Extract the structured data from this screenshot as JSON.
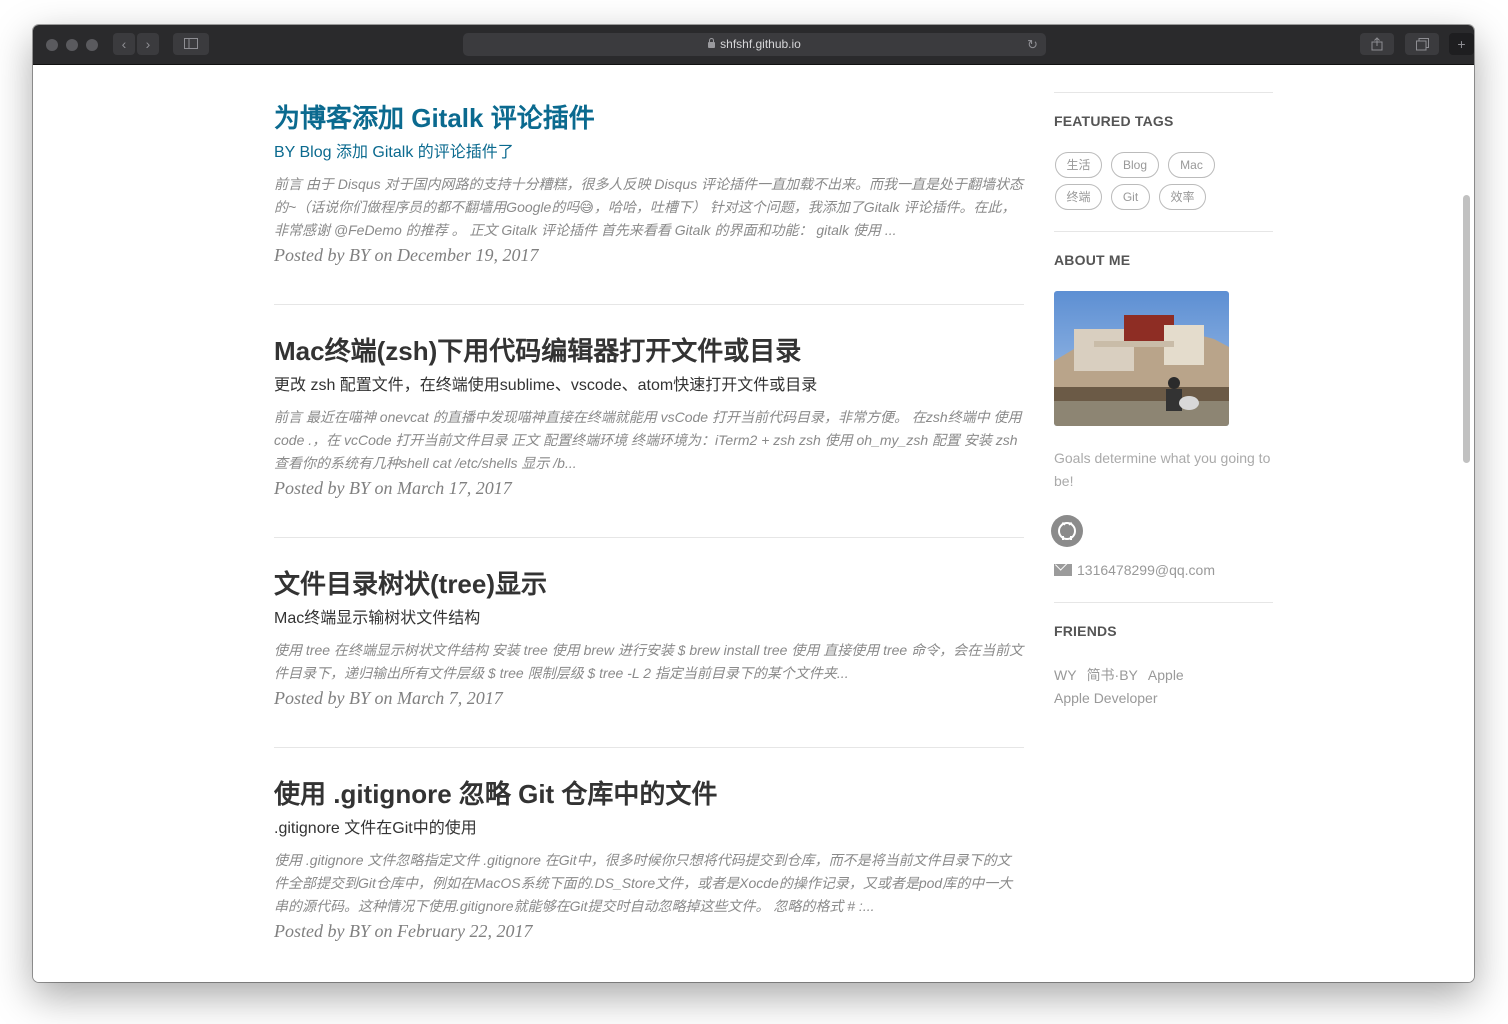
{
  "browser": {
    "url": "shfshf.github.io",
    "back_glyph": "‹",
    "forward_glyph": "›",
    "reload_glyph": "↻"
  },
  "posts": [
    {
      "title": "为博客添加 Gitalk 评论插件",
      "subtitle": "BY Blog 添加 Gitalk 的评论插件了",
      "excerpt": "前言 由于 Disqus 对于国内网路的支持十分糟糕，很多人反映 Disqus 评论插件一直加载不出来。而我一直是处于翻墙状态的~（话说你们做程序员的都不翻墙用Google的吗😅，哈哈，吐槽下） 针对这个问题，我添加了Gitalk 评论插件。在此，非常感谢 @FeDemo 的推荐 。 正文 Gitalk 评论插件 首先来看看 Gitalk 的界面和功能： gitalk 使用 ...",
      "meta": "Posted by BY on December 19, 2017"
    },
    {
      "title": "Mac终端(zsh)下用代码编辑器打开文件或目录",
      "subtitle": "更改 zsh 配置文件，在终端使用sublime、vscode、atom快速打开文件或目录",
      "excerpt": "前言 最近在喵神 onevcat 的直播中发现喵神直接在终端就能用 vsCode 打开当前代码目录，非常方便。 在zsh终端中 使用 code .，在 vcCode 打开当前文件目录 正文 配置终端环境 终端环境为：iTerm2 + zsh zsh 使用 oh_my_zsh 配置 安装 zsh 查看你的系统有几种shell cat /etc/shells 显示 /b...",
      "meta": "Posted by BY on March 17, 2017"
    },
    {
      "title": "文件目录树状(tree)显示",
      "subtitle": "Mac终端显示输树状文件结构",
      "excerpt": "使用 tree 在终端显示树状文件结构 安装 tree 使用 brew 进行安装 $ brew install tree 使用 直接使用 tree 命令，会在当前文件目录下，递归输出所有文件层级 $ tree 限制层级 $ tree -L 2 指定当前目录下的某个文件夹...",
      "meta": "Posted by BY on March 7, 2017"
    },
    {
      "title": "使用 .gitignore 忽略 Git 仓库中的文件",
      "subtitle": ".gitignore 文件在Git中的使用",
      "excerpt": "使用 .gitignore 文件忽略指定文件 .gitignore 在Git中，很多时候你只想将代码提交到仓库，而不是将当前文件目录下的文件全部提交到Git仓库中，例如在MacOS系统下面的.DS_Store文件，或者是Xocde的操作记录，又或者是pod库的中一大串的源代码。这种情况下使用.gitignore就能够在Git提交时自动忽略掉这些文件。 忽略的格式 # :...",
      "meta": "Posted by BY on February 22, 2017"
    }
  ],
  "sidebar": {
    "featured_tags_heading": "FEATURED TAGS",
    "tags": [
      "生活",
      "Blog",
      "Mac",
      "终端",
      "Git",
      "效率"
    ],
    "about_heading": "ABOUT ME",
    "bio": "Goals determine what you going to be!",
    "email": "1316478299@qq.com",
    "friends_heading": "FRIENDS",
    "friends": [
      "WY",
      "简书·BY",
      "Apple",
      "Apple Developer"
    ]
  },
  "colors": {
    "accent": "#0b6a8f",
    "toolbar": "#2a2a2c"
  }
}
